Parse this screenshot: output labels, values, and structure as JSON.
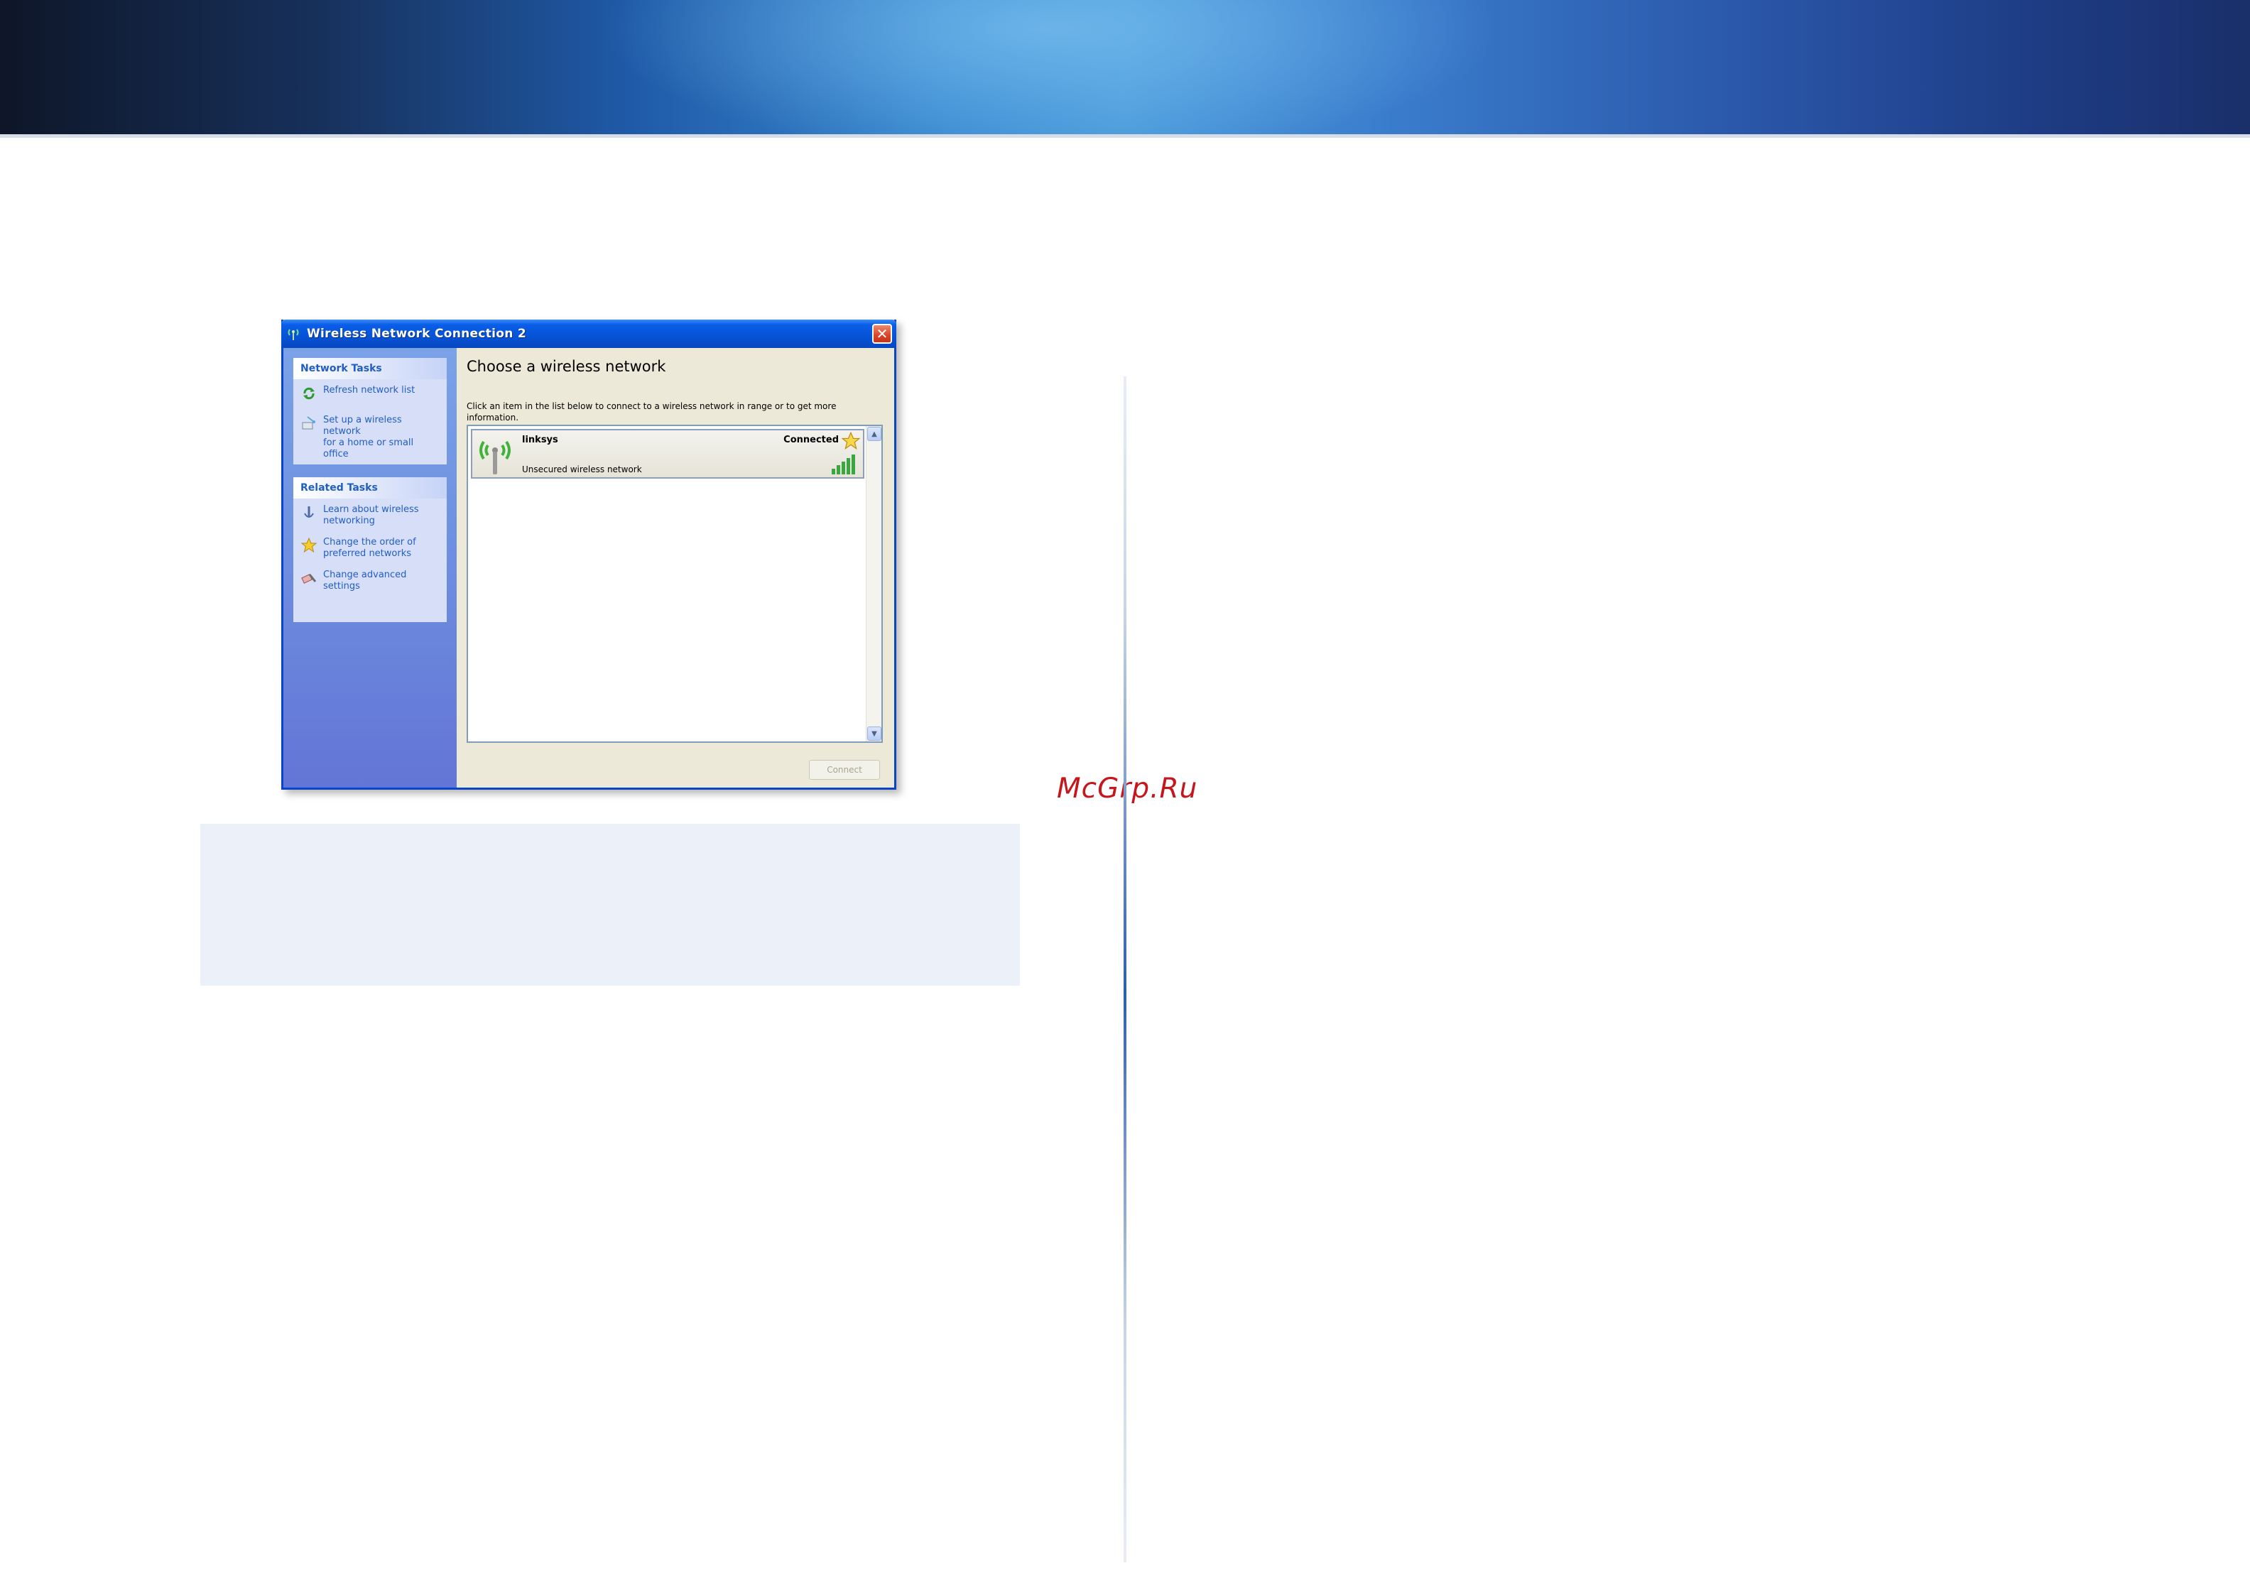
{
  "brand_colors": {
    "banner_dark": "#0e1628",
    "banner_light": "#4a9ada",
    "xp_blue": "#0653d6",
    "watermark_red": "#c6161b",
    "note_bg": "#ebf0f9"
  },
  "watermark": "McGrp.Ru",
  "dialog": {
    "title": "Wireless Network Connection 2",
    "title_icon": "wireless-connection-icon",
    "close_icon": "close-icon",
    "network_tasks": {
      "header": "Network Tasks",
      "items": [
        {
          "label": "Refresh network list",
          "icon": "refresh-icon"
        },
        {
          "label": "Set up a wireless network\nfor a home or small office",
          "icon": "setup-network-icon"
        }
      ]
    },
    "related_tasks": {
      "header": "Related Tasks",
      "items": [
        {
          "label": "Learn about wireless\nnetworking",
          "icon": "info-icon"
        },
        {
          "label": "Change the order of\npreferred networks",
          "icon": "star-icon"
        },
        {
          "label": "Change advanced\nsettings",
          "icon": "settings-icon"
        }
      ]
    },
    "main": {
      "heading": "Choose a wireless network",
      "description": "Click an item in the list below to connect to a wireless network in range or to get more information.",
      "networks": [
        {
          "name": "linksys",
          "status": "Connected",
          "security": "Unsecured wireless network",
          "signal_icon": "signal-strength-icon",
          "signal_bars": 5
        }
      ],
      "connect_button": "Connect"
    }
  }
}
